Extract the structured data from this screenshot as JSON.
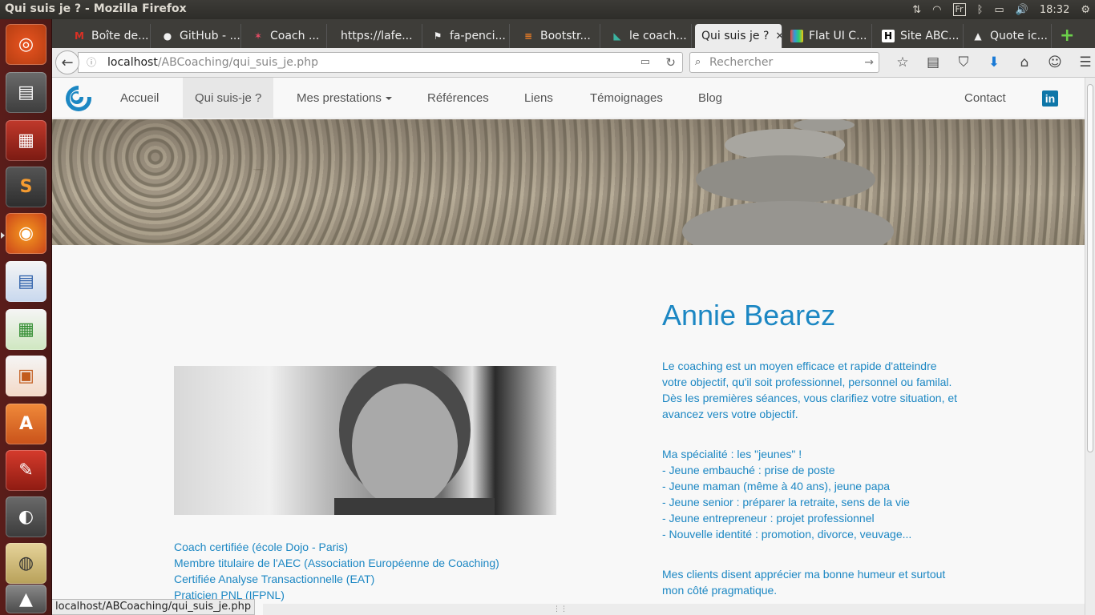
{
  "window": {
    "title": "Qui suis je ? - Mozilla Firefox",
    "time": "18:32",
    "kb_layout": "Fr"
  },
  "launcher_icons": [
    "ubuntu-icon",
    "files-icon",
    "terminal-icon",
    "sublime-icon",
    "firefox-icon",
    "writer-icon",
    "calc-icon",
    "impress-icon",
    "software-center-icon",
    "settings-icon",
    "gimp-icon",
    "image-viewer-icon",
    "inkscape-icon"
  ],
  "tabs": [
    {
      "label": "Boîte de...",
      "icon": "gmail-icon"
    },
    {
      "label": "GitHub - ...",
      "icon": "github-icon"
    },
    {
      "label": "Coach ...",
      "icon": "star-icon"
    },
    {
      "label": "https://lafe...",
      "icon": ""
    },
    {
      "label": "fa-penci...",
      "icon": "flag-icon"
    },
    {
      "label": "Bootstr...",
      "icon": "stackoverflow-icon"
    },
    {
      "label": "le coach...",
      "icon": "bookmark-icon"
    },
    {
      "label": "Qui suis je ?",
      "icon": ""
    },
    {
      "label": "Flat UI C...",
      "icon": "flatui-icon"
    },
    {
      "label": "Site ABC...",
      "icon": "h-icon"
    },
    {
      "label": "Quote ic...",
      "icon": "drop-icon"
    }
  ],
  "urlbar": {
    "host": "localhost",
    "path": "/ABCoaching/qui_suis_je.php"
  },
  "search": {
    "placeholder": "Rechercher"
  },
  "site": {
    "nav": {
      "accueil": "Accueil",
      "qui": "Qui suis-je ?",
      "prestations": "Mes prestations",
      "references": "Références",
      "liens": "Liens",
      "temoignages": "Témoignages",
      "blog": "Blog",
      "contact": "Contact",
      "linkedin": "in"
    },
    "name": "Annie Bearez",
    "intro": [
      "Le coaching est un moyen efficace et rapide d'atteindre",
      "votre objectif, qu'il soit professionnel, personnel ou familal.",
      "Dès les premières séances, vous clarifiez votre situation, et",
      "avancez vers votre objectif."
    ],
    "specialty": [
      "Ma spécialité : les \"jeunes\" !",
      "- Jeune embauché : prise de poste",
      "- Jeune maman (même à 40 ans), jeune papa",
      "- Jeune senior : préparer la retraite, sens de la vie",
      "- Jeune entrepreneur : projet professionnel",
      "- Nouvelle identité : promotion, divorce, veuvage..."
    ],
    "clients": [
      "Mes clients disent apprécier ma bonne humeur et surtout",
      "mon côté pragmatique."
    ],
    "qualifications": [
      "Coach certifiée (école Dojo - Paris)",
      "Membre titulaire de l'AEC (Association Européenne de Coaching)",
      "Certifiée Analyse Transactionnelle (EAT)",
      "Praticien PNL (IFPNL)"
    ]
  },
  "statusbar": {
    "url": "localhost/ABCoaching/qui_suis_je.php"
  }
}
